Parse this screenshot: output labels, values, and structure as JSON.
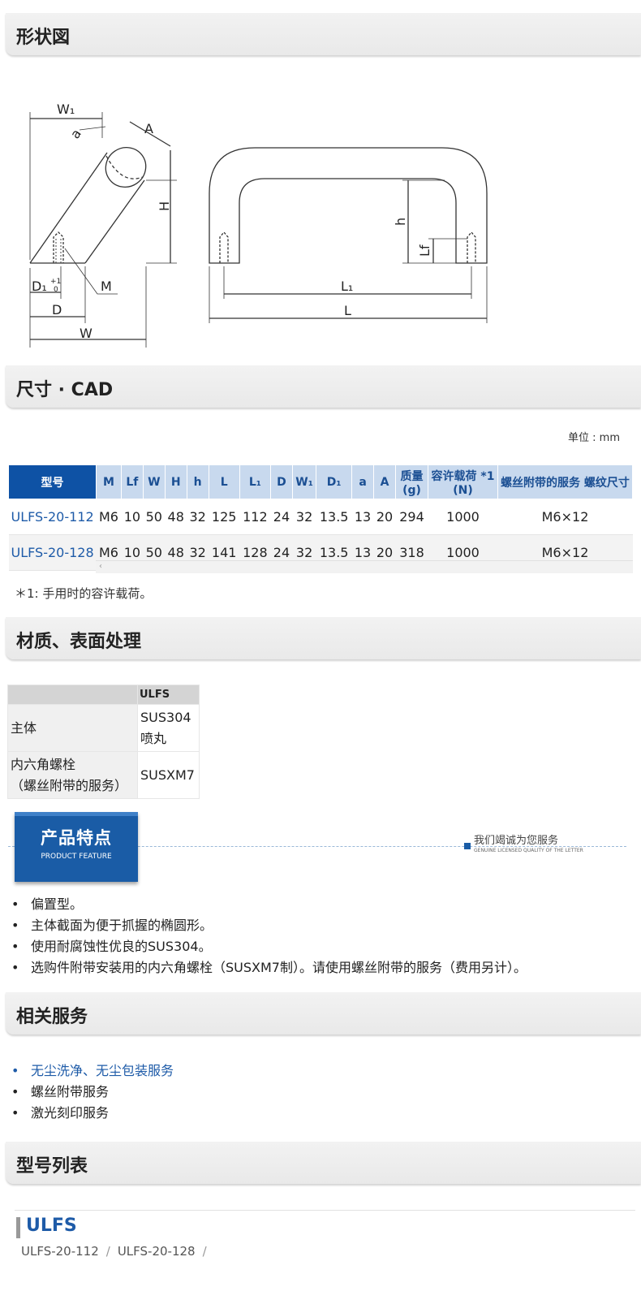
{
  "sections": {
    "shape": "形状図",
    "dimensions": "尺寸 · CAD",
    "material": "材质、表面处理",
    "related": "相关服务",
    "models": "型号列表"
  },
  "drawing_labels": {
    "W1": "W₁",
    "a": "a",
    "A": "A",
    "H": "H",
    "D1": "D₁",
    "tol": "+1",
    "tol0": "0",
    "M": "M",
    "D": "D",
    "W": "W",
    "h": "h",
    "Lf": "Lf",
    "L1": "L₁",
    "L": "L"
  },
  "unit": "单位 : mm",
  "spec_table": {
    "headers": [
      "型号",
      "M",
      "Lf",
      "W",
      "H",
      "h",
      "L",
      "L₁",
      "D",
      "W₁",
      "D₁",
      "a",
      "A",
      "质量 (g)",
      "容许载荷 *1 (N)",
      "螺丝附带的服务 螺纹尺寸"
    ],
    "rows": [
      [
        "ULFS-20-112",
        "M6",
        "10",
        "50",
        "48",
        "32",
        "125",
        "112",
        "24",
        "32",
        "13.5",
        "13",
        "20",
        "294",
        "1000",
        "M6×12"
      ],
      [
        "ULFS-20-128",
        "M6",
        "10",
        "50",
        "48",
        "32",
        "141",
        "128",
        "24",
        "32",
        "13.5",
        "13",
        "20",
        "318",
        "1000",
        "M6×12"
      ]
    ]
  },
  "scroll_arrow": "‹",
  "note": "＊1:   手用时的容许载荷。",
  "material_table": {
    "header": [
      "",
      "ULFS"
    ],
    "rows": [
      {
        "label": "主体",
        "value1": "SUS304",
        "value2": "喷丸"
      },
      {
        "label1": "内六角螺栓",
        "label2": "（螺丝附带的服务）",
        "value": "SUSXM7"
      }
    ]
  },
  "feature_badge": {
    "cn": "产品特点",
    "en": "PRODUCT FEATURE"
  },
  "slogan": {
    "line1": "我们竭诚为您服务",
    "line2": "GENUINE LICENSED QUALITY OF THE LETTER"
  },
  "features": [
    "偏置型。",
    "主体截面为便于抓握的椭圆形。",
    "使用耐腐蚀性优良的SUS304。",
    "选购件附带安装用的内六角螺栓（SUSXM7制）。请使用螺丝附带的服务（费用另计）。"
  ],
  "related_services": [
    "无尘洗净、无尘包装服务",
    "螺丝附带服务",
    "激光刻印服务"
  ],
  "model_list": {
    "title": "ULFS",
    "items": [
      "ULFS-20-112",
      "ULFS-20-128"
    ],
    "separator": "/"
  }
}
